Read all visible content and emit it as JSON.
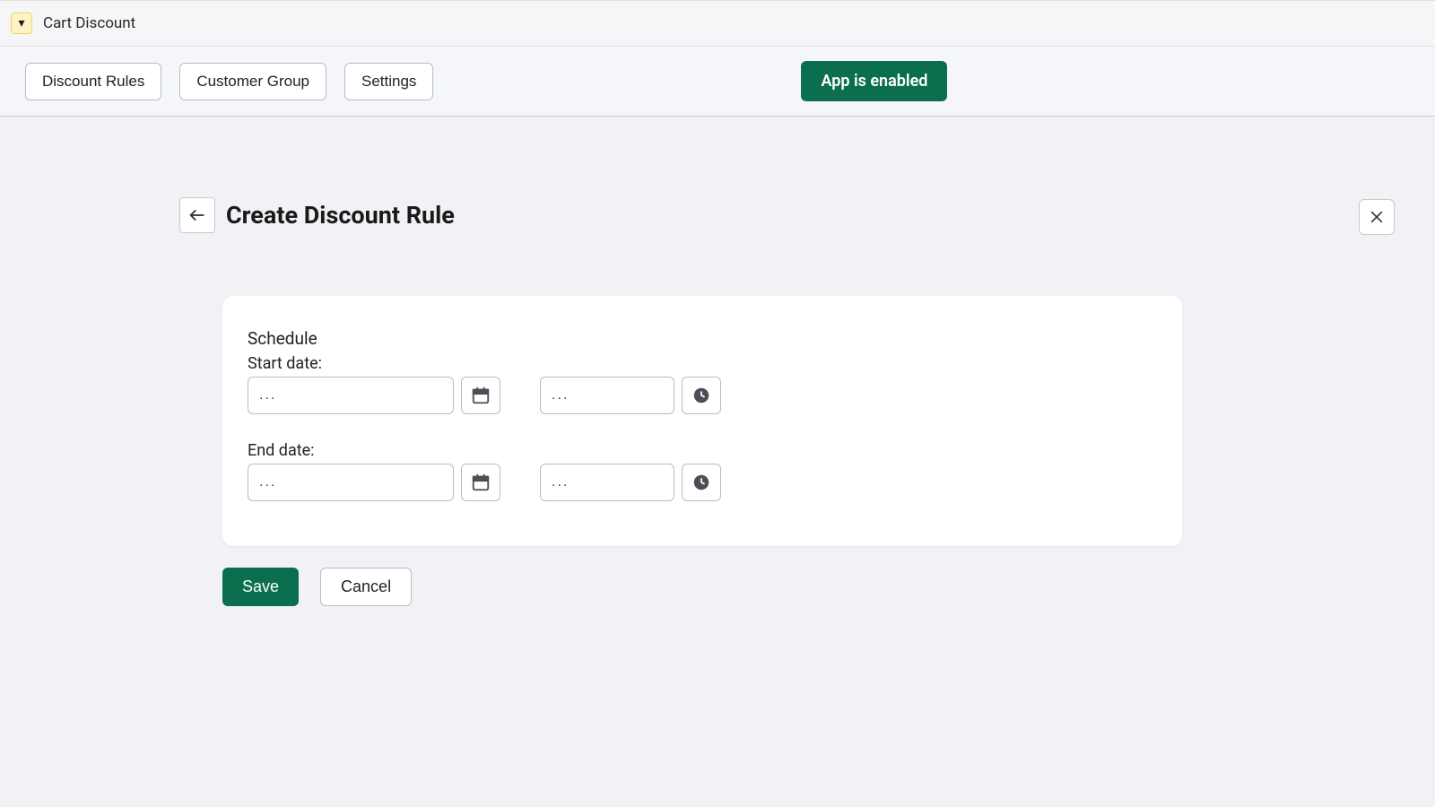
{
  "app": {
    "icon_glyph": "▾",
    "title": "Cart Discount"
  },
  "nav": {
    "discount_rules": "Discount Rules",
    "customer_group": "Customer Group",
    "settings": "Settings",
    "status": "App is enabled"
  },
  "page": {
    "title": "Create Discount Rule"
  },
  "form": {
    "section_title": "Schedule",
    "start_label": "Start date:",
    "end_label": "End date:",
    "start_date_value": "",
    "start_date_placeholder": "...",
    "start_time_value": "",
    "start_time_placeholder": "...",
    "end_date_value": "",
    "end_date_placeholder": "...",
    "end_time_value": "",
    "end_time_placeholder": "..."
  },
  "actions": {
    "save": "Save",
    "cancel": "Cancel"
  }
}
